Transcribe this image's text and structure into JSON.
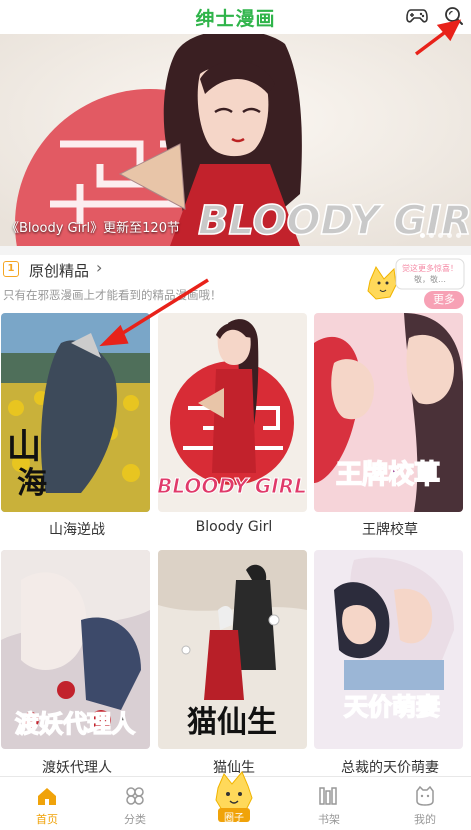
{
  "header": {
    "title": "绅士漫画",
    "icons": [
      "gamepad-icon",
      "search-icon"
    ]
  },
  "banner": {
    "caption": "《Bloody Girl》更新至120节",
    "art_text": "BLOODY GIRL",
    "dots": 5,
    "active_dot": 0
  },
  "section": {
    "title": "原创精品",
    "subtitle": "只有在邪恶漫画上才能看到的精品漫画哦！",
    "mascot_text": "觉这更多惊喜！敬，敬…",
    "more_label": "更多"
  },
  "comics": [
    {
      "title": "山海逆战",
      "cover_text": "山海",
      "bg": "#3a5a3a"
    },
    {
      "title": "Bloody Girl",
      "cover_text": "BLOODY GIRL",
      "bg": "#c8242f"
    },
    {
      "title": "王牌校草",
      "cover_text": "王牌校草",
      "bg": "#e86a7a"
    },
    {
      "title": "渡妖代理人",
      "cover_text": "渡妖代理人",
      "bg": "#c9b6c2"
    },
    {
      "title": "猫仙生",
      "cover_text": "猫仙生",
      "bg": "#e5e0d9"
    },
    {
      "title": "总裁的天价萌妻",
      "cover_text": "天价萌妻",
      "bg": "#d9c8d8"
    }
  ],
  "tabs": [
    {
      "label": "首页",
      "icon": "home-icon",
      "active": true
    },
    {
      "label": "分类",
      "icon": "clover-icon",
      "active": false
    },
    {
      "label": "圈子",
      "icon": "circle-icon",
      "active": false
    },
    {
      "label": "书架",
      "icon": "bookshelf-icon",
      "active": false
    },
    {
      "label": "我的",
      "icon": "profile-icon",
      "active": false
    }
  ],
  "colors": {
    "brand_green": "#2fb44a",
    "accent_orange": "#f0a30a",
    "more_pink": "#f7a1b5",
    "annotation_red": "#e8221a"
  }
}
